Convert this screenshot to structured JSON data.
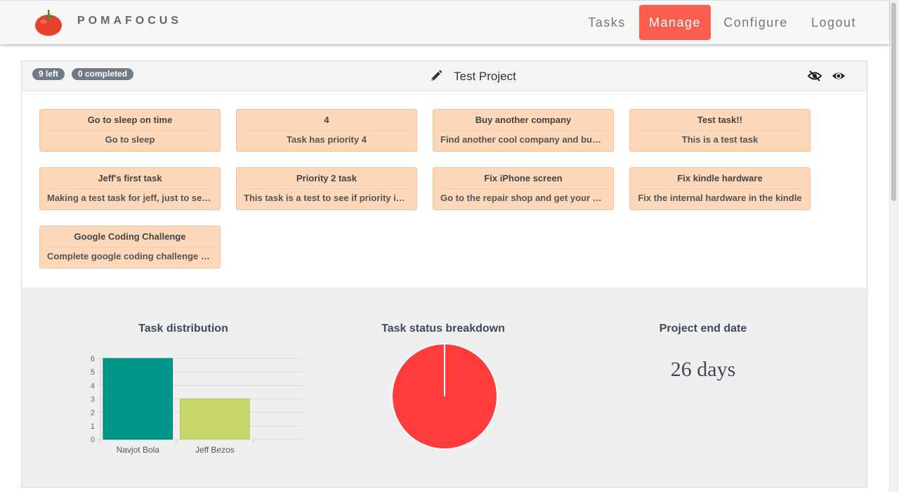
{
  "nav": {
    "brand": "POMAFOCUS",
    "items": [
      {
        "label": "Tasks",
        "active": false
      },
      {
        "label": "Manage",
        "active": true
      },
      {
        "label": "Configure",
        "active": false
      },
      {
        "label": "Logout",
        "active": false
      }
    ]
  },
  "project": {
    "badges": {
      "left": "9 left",
      "completed": "0 completed"
    },
    "title": "Test Project",
    "icons": [
      "pencil-icon",
      "eye-slash-icon",
      "eye-icon"
    ]
  },
  "tasks": [
    {
      "title": "Go to sleep on time",
      "description": "Go to sleep"
    },
    {
      "title": "4",
      "description": "Task has priority 4"
    },
    {
      "title": "Buy another company",
      "description": "Find another cool company and buy it."
    },
    {
      "title": "Test task!!",
      "description": "This is a test task"
    },
    {
      "title": "Jeff's first task",
      "description": "Making a test task for jeff, just to see if it works"
    },
    {
      "title": "Priority 2 task",
      "description": "This task is a test to see if priority is set"
    },
    {
      "title": "Fix iPhone screen",
      "description": "Go to the repair shop and get your screen fixed"
    },
    {
      "title": "Fix kindle hardware",
      "description": "Fix the internal hardware in the kindle"
    },
    {
      "title": "Google Coding Challenge",
      "description": "Complete google coding challenge again"
    }
  ],
  "stats": {
    "distribution_title": "Task distribution",
    "status_title": "Task status breakdown",
    "end_date_title": "Project end date",
    "end_date_value": "26 days"
  },
  "chart_data": [
    {
      "type": "bar",
      "title": "Task distribution",
      "categories": [
        "Navjot Bola",
        "Jeff Bezos"
      ],
      "values": [
        6,
        3
      ],
      "colors": [
        "#009688",
        "#c8d66b"
      ],
      "ylim": [
        0,
        6
      ],
      "yticks": [
        0,
        1,
        2,
        3,
        4,
        5,
        6
      ],
      "grid": true
    },
    {
      "type": "pie",
      "title": "Task status breakdown",
      "values": [
        9
      ],
      "colors": [
        "#ff3b3b"
      ]
    }
  ],
  "colors": {
    "accent": "#fb5d4f",
    "task_card": "#fdd7b9",
    "badge": "#6e7b86"
  }
}
